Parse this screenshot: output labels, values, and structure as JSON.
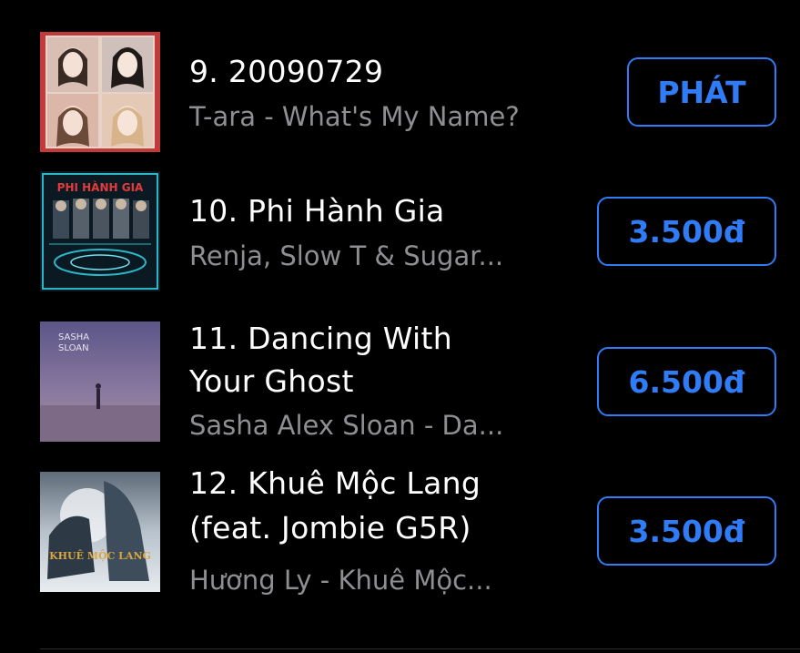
{
  "songs": [
    {
      "title": "9. 20090729",
      "subtitle": "T-ara - What's My Name?",
      "button": "PHÁT",
      "art_icon": "album-art-tara"
    },
    {
      "title": "10. Phi Hành Gia",
      "subtitle": "Renja, Slow T & Sugar...",
      "button": "3.500đ",
      "art_icon": "album-art-phi-hanh-gia",
      "art_text": "PHI HÀNH GIA"
    },
    {
      "title_line1": "11. Dancing With",
      "title_line2": "Your Ghost",
      "subtitle": "Sasha Alex Sloan - Da...",
      "button": "6.500đ",
      "art_icon": "album-art-sasha-sloan",
      "art_text_line1": "SASHA",
      "art_text_line2": "SLOAN"
    },
    {
      "title_line1": "12. Khuê Mộc Lang",
      "title_line2": "(feat. Jombie G5R)",
      "subtitle": "Hương Ly - Khuê Mộc...",
      "button": "3.500đ",
      "art_icon": "album-art-khue-moc-lang",
      "art_text": "KHUÊ MỘC LANG"
    }
  ],
  "colors": {
    "background": "#000000",
    "accent": "#2f7cf6",
    "primary_text": "#ffffff",
    "secondary_text": "#8e8e93"
  }
}
